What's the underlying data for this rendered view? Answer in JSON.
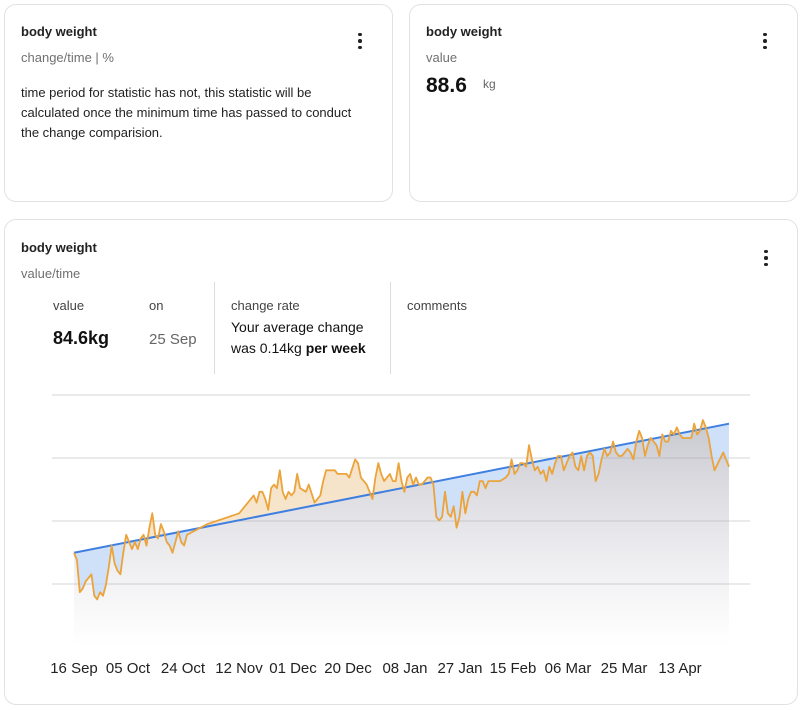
{
  "card_change": {
    "title": "body weight",
    "subtitle": "change/time | %",
    "message": "time period for statistic has not, this statistic will be calculated once the minimum time has passed to conduct the change comparision."
  },
  "card_value": {
    "title": "body weight",
    "subtitle": "value",
    "value": "88.6",
    "unit": "kg"
  },
  "card_chart": {
    "title": "body weight",
    "subtitle": "value/time",
    "stats": {
      "value_label": "value",
      "value": "84.6kg",
      "on_label": "on",
      "on_date": "25 Sep",
      "change_label": "change rate",
      "change_text_1": "Your average change",
      "change_text_2": "was 0.14kg ",
      "change_text_bold": "per week",
      "comments_label": "comments"
    }
  },
  "colors": {
    "line": "#eba33a",
    "trend": "#3f7fe0",
    "grid": "#d4d4d4"
  },
  "chart_data": {
    "type": "line",
    "x_start": "2022-09-16",
    "x_end": "2023-04-30",
    "tick_labels": [
      "16 Sep",
      "05 Oct",
      "24 Oct",
      "12 Nov",
      "01 Dec",
      "20 Dec",
      "08 Jan",
      "27 Jan",
      "15 Feb",
      "06 Mar",
      "25 Mar",
      "13 Apr"
    ],
    "grid": true,
    "series": [
      {
        "values": [
          [
            "2022-09-16",
            84.6
          ],
          [
            "2022-09-17",
            84.4
          ],
          [
            "2022-09-18",
            83.5
          ],
          [
            "2022-09-19",
            83.6
          ],
          [
            "2022-09-20",
            83.8
          ],
          [
            "2022-09-22",
            84.0
          ],
          [
            "2022-09-23",
            83.4
          ],
          [
            "2022-09-24",
            83.3
          ],
          [
            "2022-09-25",
            83.5
          ],
          [
            "2022-09-26",
            83.4
          ],
          [
            "2022-09-27",
            83.7
          ],
          [
            "2022-09-28",
            84.2
          ],
          [
            "2022-09-29",
            84.8
          ],
          [
            "2022-09-30",
            84.3
          ],
          [
            "2022-10-01",
            84.1
          ],
          [
            "2022-10-02",
            84.0
          ],
          [
            "2022-10-03",
            84.6
          ],
          [
            "2022-10-04",
            85.1
          ],
          [
            "2022-10-05",
            84.9
          ],
          [
            "2022-10-06",
            84.7
          ],
          [
            "2022-10-07",
            84.9
          ],
          [
            "2022-10-08",
            84.7
          ],
          [
            "2022-10-09",
            85.0
          ],
          [
            "2022-10-10",
            85.1
          ],
          [
            "2022-10-11",
            84.8
          ],
          [
            "2022-10-12",
            85.3
          ],
          [
            "2022-10-13",
            85.7
          ],
          [
            "2022-10-14",
            85.1
          ],
          [
            "2022-10-15",
            85.0
          ],
          [
            "2022-10-16",
            85.4
          ],
          [
            "2022-10-17",
            85.2
          ],
          [
            "2022-10-18",
            84.9
          ],
          [
            "2022-10-19",
            84.8
          ],
          [
            "2022-10-20",
            84.6
          ],
          [
            "2022-10-22",
            85.2
          ],
          [
            "2022-10-23",
            84.9
          ],
          [
            "2022-10-24",
            84.8
          ],
          [
            "2022-10-25",
            85.1
          ],
          [
            "2022-11-01",
            85.4
          ],
          [
            "2022-11-12",
            85.7
          ],
          [
            "2022-11-17",
            86.2
          ],
          [
            "2022-11-18",
            86.0
          ],
          [
            "2022-11-19",
            86.3
          ],
          [
            "2022-11-20",
            86.3
          ],
          [
            "2022-11-21",
            86.1
          ],
          [
            "2022-11-22",
            85.8
          ],
          [
            "2022-11-23",
            86.4
          ],
          [
            "2022-11-24",
            86.5
          ],
          [
            "2022-11-25",
            86.4
          ],
          [
            "2022-11-26",
            86.9
          ],
          [
            "2022-11-27",
            86.3
          ],
          [
            "2022-11-28",
            86.1
          ],
          [
            "2022-11-29",
            86.3
          ],
          [
            "2022-11-30",
            86.2
          ],
          [
            "2022-12-01",
            86.3
          ],
          [
            "2022-12-02",
            86.8
          ],
          [
            "2022-12-03",
            86.4
          ],
          [
            "2022-12-05",
            86.3
          ],
          [
            "2022-12-06",
            86.5
          ],
          [
            "2022-12-08",
            86.0
          ],
          [
            "2022-12-10",
            86.2
          ],
          [
            "2022-12-11",
            86.6
          ],
          [
            "2022-12-12",
            86.9
          ],
          [
            "2022-12-15",
            86.9
          ],
          [
            "2022-12-16",
            86.8
          ],
          [
            "2022-12-19",
            86.8
          ],
          [
            "2022-12-20",
            86.7
          ],
          [
            "2022-12-22",
            87.2
          ],
          [
            "2022-12-23",
            87.1
          ],
          [
            "2022-12-24",
            86.7
          ],
          [
            "2022-12-25",
            86.6
          ],
          [
            "2022-12-26",
            86.5
          ],
          [
            "2022-12-27",
            86.3
          ],
          [
            "2022-12-28",
            86.1
          ],
          [
            "2022-12-29",
            86.7
          ],
          [
            "2022-12-30",
            87.1
          ],
          [
            "2022-12-31",
            86.8
          ],
          [
            "2023-01-01",
            86.6
          ],
          [
            "2023-01-03",
            86.8
          ],
          [
            "2023-01-04",
            86.6
          ],
          [
            "2023-01-05",
            86.6
          ],
          [
            "2023-01-06",
            87.1
          ],
          [
            "2023-01-07",
            86.6
          ],
          [
            "2023-01-08",
            86.3
          ],
          [
            "2023-01-09",
            86.7
          ],
          [
            "2023-01-10",
            86.8
          ],
          [
            "2023-01-11",
            86.5
          ],
          [
            "2023-01-12",
            86.7
          ],
          [
            "2023-01-13",
            86.5
          ],
          [
            "2023-01-14",
            86.5
          ],
          [
            "2023-01-15",
            86.6
          ],
          [
            "2023-01-16",
            86.7
          ],
          [
            "2023-01-17",
            86.7
          ],
          [
            "2023-01-18",
            86.5
          ],
          [
            "2023-01-19",
            85.6
          ],
          [
            "2023-01-20",
            85.5
          ],
          [
            "2023-01-21",
            85.6
          ],
          [
            "2023-01-22",
            86.3
          ],
          [
            "2023-01-23",
            85.7
          ],
          [
            "2023-01-24",
            85.6
          ],
          [
            "2023-01-25",
            85.9
          ],
          [
            "2023-01-26",
            85.3
          ],
          [
            "2023-01-27",
            85.6
          ],
          [
            "2023-01-28",
            86.3
          ],
          [
            "2023-01-29",
            85.7
          ],
          [
            "2023-01-30",
            86.1
          ],
          [
            "2023-01-31",
            86.3
          ],
          [
            "2023-02-01",
            86.3
          ],
          [
            "2023-02-02",
            86.2
          ],
          [
            "2023-02-03",
            86.6
          ],
          [
            "2023-02-04",
            86.6
          ],
          [
            "2023-02-05",
            86.4
          ],
          [
            "2023-02-06",
            86.6
          ],
          [
            "2023-02-07",
            86.6
          ],
          [
            "2023-02-08",
            86.6
          ],
          [
            "2023-02-09",
            86.6
          ],
          [
            "2023-02-10",
            86.6
          ],
          [
            "2023-02-12",
            86.7
          ],
          [
            "2023-02-13",
            86.8
          ],
          [
            "2023-02-14",
            87.2
          ],
          [
            "2023-02-15",
            86.8
          ],
          [
            "2023-02-16",
            86.9
          ],
          [
            "2023-02-17",
            87.1
          ],
          [
            "2023-02-18",
            87.1
          ],
          [
            "2023-02-19",
            87.0
          ],
          [
            "2023-02-20",
            87.6
          ],
          [
            "2023-02-21",
            87.2
          ],
          [
            "2023-02-22",
            86.9
          ],
          [
            "2023-02-23",
            87.0
          ],
          [
            "2023-02-24",
            86.8
          ],
          [
            "2023-02-25",
            86.9
          ],
          [
            "2023-02-26",
            86.6
          ],
          [
            "2023-02-27",
            87.0
          ],
          [
            "2023-02-28",
            86.8
          ],
          [
            "2023-03-01",
            87.1
          ],
          [
            "2023-03-02",
            87.3
          ],
          [
            "2023-03-03",
            87.3
          ],
          [
            "2023-03-04",
            86.9
          ],
          [
            "2023-03-05",
            87.1
          ],
          [
            "2023-03-06",
            87.3
          ],
          [
            "2023-03-07",
            87.4
          ],
          [
            "2023-03-08",
            87.0
          ],
          [
            "2023-03-09",
            86.9
          ],
          [
            "2023-03-10",
            87.3
          ],
          [
            "2023-03-11",
            86.9
          ],
          [
            "2023-03-12",
            87.3
          ],
          [
            "2023-03-13",
            87.4
          ],
          [
            "2023-03-14",
            87.3
          ],
          [
            "2023-03-15",
            86.6
          ],
          [
            "2023-03-16",
            86.8
          ],
          [
            "2023-03-17",
            87.2
          ],
          [
            "2023-03-18",
            87.5
          ],
          [
            "2023-03-19",
            87.3
          ],
          [
            "2023-03-20",
            87.4
          ],
          [
            "2023-03-21",
            87.7
          ],
          [
            "2023-03-22",
            87.4
          ],
          [
            "2023-03-23",
            87.3
          ],
          [
            "2023-03-24",
            87.3
          ],
          [
            "2023-03-25",
            87.4
          ],
          [
            "2023-03-26",
            87.5
          ],
          [
            "2023-03-27",
            87.4
          ],
          [
            "2023-03-28",
            87.2
          ],
          [
            "2023-03-29",
            87.7
          ],
          [
            "2023-03-30",
            88.0
          ],
          [
            "2023-03-31",
            87.8
          ],
          [
            "2023-04-01",
            87.3
          ],
          [
            "2023-04-02",
            87.6
          ],
          [
            "2023-04-03",
            87.8
          ],
          [
            "2023-04-04",
            87.7
          ],
          [
            "2023-04-05",
            87.6
          ],
          [
            "2023-04-06",
            87.3
          ],
          [
            "2023-04-07",
            87.9
          ],
          [
            "2023-04-08",
            87.7
          ],
          [
            "2023-04-09",
            87.7
          ],
          [
            "2023-04-10",
            88.0
          ],
          [
            "2023-04-11",
            87.9
          ],
          [
            "2023-04-12",
            88.1
          ],
          [
            "2023-04-13",
            87.9
          ],
          [
            "2023-04-14",
            87.8
          ],
          [
            "2023-04-15",
            87.8
          ],
          [
            "2023-04-16",
            87.8
          ],
          [
            "2023-04-17",
            87.8
          ],
          [
            "2023-04-18",
            88.2
          ],
          [
            "2023-04-19",
            87.9
          ],
          [
            "2023-04-20",
            88.0
          ],
          [
            "2023-04-21",
            88.3
          ],
          [
            "2023-04-22",
            88.1
          ],
          [
            "2023-04-23",
            87.8
          ],
          [
            "2023-04-24",
            87.3
          ],
          [
            "2023-04-25",
            86.9
          ],
          [
            "2023-04-28",
            87.4
          ],
          [
            "2023-04-30",
            87.0
          ]
        ]
      }
    ],
    "trend": [
      [
        "2022-09-16",
        84.6
      ],
      [
        "2023-04-30",
        88.2
      ]
    ]
  }
}
